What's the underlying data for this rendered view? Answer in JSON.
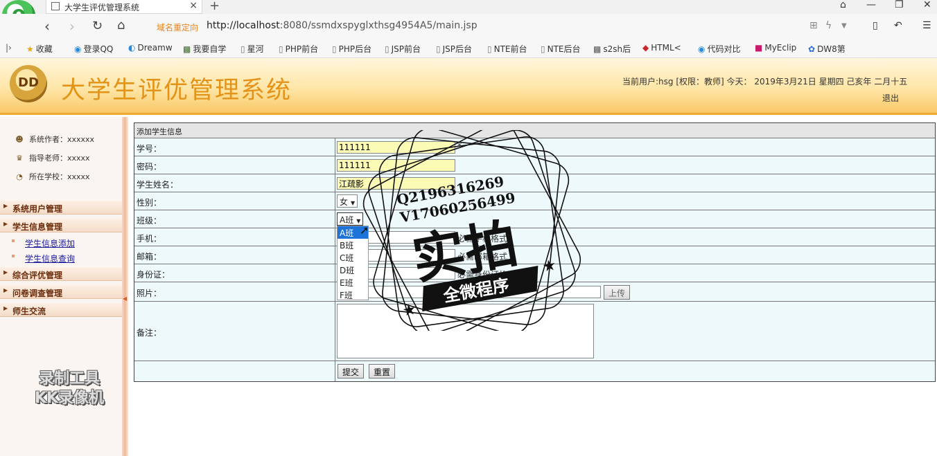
{
  "browser": {
    "tab_title": "大学生评优管理系统",
    "tab_close": "×",
    "new_tab": "+",
    "redirect_label": "域名重定向",
    "url_host": "http://localhost",
    "url_rest": ":8080/ssmdxspyglxthsg4954A5/main.jsp",
    "bookmarks": [
      "收藏",
      "登录QQ",
      "Dreamw",
      "我要自学",
      "星河",
      "PHP前台",
      "PHP后台",
      "JSP前台",
      "JSP后台",
      "NTE前台",
      "NTE后台",
      "s2sh后",
      "HTML<",
      "代码对比",
      "MyEclip",
      "DW8第"
    ]
  },
  "header": {
    "title": "大学生评优管理系统",
    "userinfo": "当前用户:hsg [权限：教师] 今天： 2019年3月21日 星期四 己亥年 二月十五",
    "logout": "退出"
  },
  "sidebar": {
    "info": [
      "系统作者：xxxxxx",
      "指导老师：xxxxx",
      "所在学校：xxxxx"
    ],
    "menus": [
      "系统用户管理",
      "学生信息管理",
      "综合评优管理",
      "问卷调查管理",
      "师生交流"
    ],
    "sub_items": [
      "学生信息添加",
      "学生信息查询"
    ],
    "recorder_line1": "录制工具",
    "recorder_line2": "KK录像机"
  },
  "form": {
    "caption": "添加学生信息",
    "labels": {
      "student_id": "学号：",
      "password": "密码：",
      "name": "学生姓名：",
      "gender": "性别：",
      "class": "班级：",
      "phone": "手机：",
      "email": "邮箱：",
      "id_card": "身份证：",
      "photo": "照片：",
      "remark": "备注："
    },
    "values": {
      "student_id": "111111",
      "password": "111111",
      "name": "江疏影",
      "gender": "女",
      "class": "A班"
    },
    "asterisk": "*",
    "hints": {
      "phone": "必需手机格式",
      "email": "必需邮箱格式",
      "id_card": "必需身份证格式"
    },
    "class_options": [
      "A班",
      "B班",
      "C班",
      "D班",
      "E班",
      "F班"
    ],
    "upload_button": "上传",
    "submit_button": "提交",
    "reset_button": "重置"
  },
  "watermark": {
    "line1": "Q2196316269",
    "line2": "V17060256499",
    "big": "实拍",
    "ribbon": "全微程序"
  }
}
